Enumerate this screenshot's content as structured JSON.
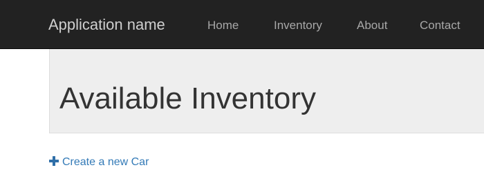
{
  "navbar": {
    "brand": "Application name",
    "links": [
      {
        "label": "Home"
      },
      {
        "label": "Inventory"
      },
      {
        "label": "About"
      },
      {
        "label": "Contact"
      }
    ]
  },
  "main": {
    "title": "Available Inventory",
    "create_link": {
      "icon": "plus-icon",
      "label": "Create a new Car"
    }
  },
  "colors": {
    "navbar_bg": "#222222",
    "jumbotron_bg": "#eeeeee",
    "link": "#337ab7"
  }
}
